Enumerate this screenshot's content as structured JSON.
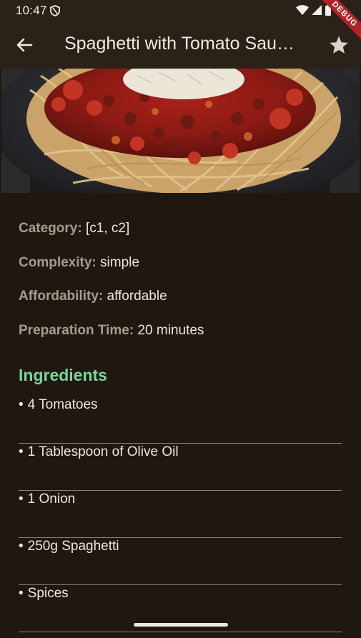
{
  "status_bar": {
    "time": "10:47",
    "icons": [
      "shield-icon",
      "wifi-icon",
      "signal-icon",
      "battery-icon"
    ],
    "debug_label": "DEBUG"
  },
  "app_bar": {
    "title": "Spaghetti with Tomato Sau…",
    "back_icon": "arrow-left-icon",
    "favorite_icon": "star-icon"
  },
  "meal": {
    "image_alt": "Spaghetti with tomato sauce and parmesan"
  },
  "details": [
    {
      "key": "Category:",
      "value": "[c1, c2]"
    },
    {
      "key": "Complexity:",
      "value": "simple"
    },
    {
      "key": "Affordability:",
      "value": "affordable"
    },
    {
      "key": "Preparation Time:",
      "value": "20 minutes"
    }
  ],
  "ingredients": {
    "heading": "Ingredients",
    "bullet": "•",
    "items": [
      "4 Tomatoes",
      "1 Tablespoon of Olive Oil",
      "1 Onion",
      "250g Spaghetti",
      "Spices"
    ]
  },
  "colors": {
    "background": "#1f1811",
    "app_bar": "#2a2118",
    "accent_heading": "#7cd59a",
    "label_muted": "#a89b8d",
    "debug_ribbon": "#b0242a"
  }
}
